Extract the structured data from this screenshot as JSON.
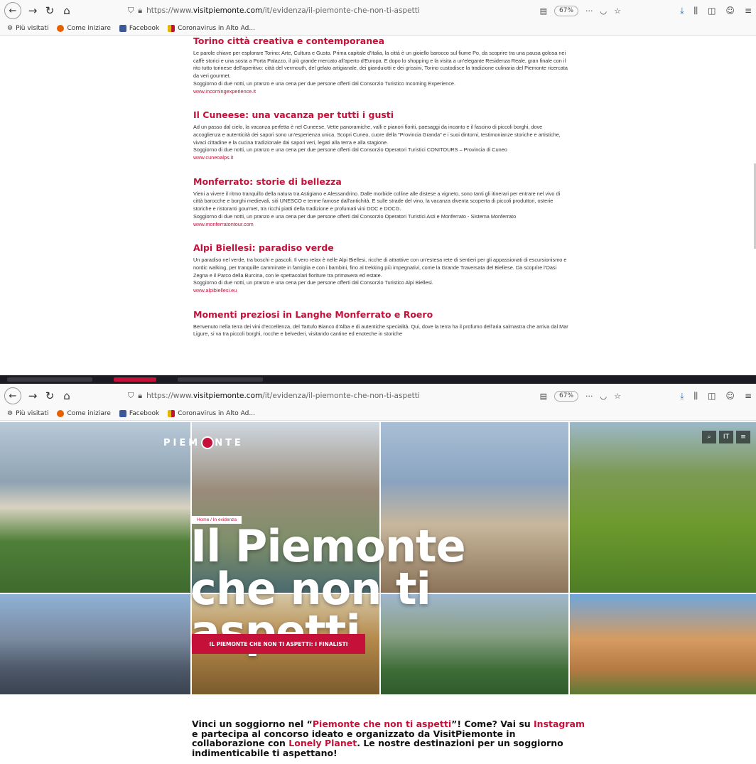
{
  "browser": {
    "url_prefix": "https://www.",
    "url_domain": "visitpiemonte.com",
    "url_path": "/it/evidenza/il-piemonte-che-non-ti-aspetti",
    "zoom": "67%",
    "more": "···",
    "bookmarks": [
      "Più visitati",
      "Come iniziare",
      "Facebook",
      "Coronavirus in Alto Ad..."
    ]
  },
  "article": {
    "sections": [
      {
        "title": "Torino città creativa e contemporanea",
        "body": "Le parole chiave per esplorare Torino: Arte, Cultura e Gusto. Prima capitale d'Italia, la città è un gioiello barocco sul fiume Po, da scoprire tra una pausa golosa nei caffè storici e una sosta a Porta Palazzo, il più grande mercato all'aperto d'Europa. E dopo lo shopping e la visita a un'elegante Residenza Reale, gran finale con il rito tutto torinese dell'aperitivo: città del vermouth, del gelato artigianale, dei gianduiotti e dei grissini, Torino custodisce la tradizione culinaria del Piemonte ricercata da veri gourmet.",
        "offer": "Soggiorno di due notti, un pranzo e una cena per due persone offerti dal Consorzio Turistico Incoming Experience.",
        "link": "www.incomingexperience.it"
      },
      {
        "title": "Il Cuneese: una vacanza per tutti i gusti",
        "body": "Ad un passo dal cielo, la vacanza perfetta è nel Cuneese. Vette panoramiche, valli e pianori fioriti, paesaggi da incanto e il fascino di piccoli borghi, dove accoglienza e autenticità dei sapori sono un'esperienza unica. Scopri Cuneo, cuore della \"Provincia Granda\" e i suoi dintorni, testimonianze storiche e artistiche, vivaci cittadine e la cucina tradizionale dai sapori veri, legati alla terra e alla stagione.",
        "offer": "Soggiorno di due notti, un pranzo e una cena per due persone offerti dal Consorzio Operatori Turistici CONITOURS – Provincia di Cuneo",
        "link": "www.cuneoalps.it"
      },
      {
        "title": "Monferrato: storie di bellezza",
        "body": "Vieni a vivere il ritmo tranquillo della natura tra Astigiano e Alessandrino. Dalle morbide colline alle distese a vigneto, sono tanti gli itinerari per entrare nel vivo di città barocche e borghi medievali, siti UNESCO e terme famose dall'antichità. E sulle strade del vino, la vacanza diventa scoperta di piccoli produttori, osterie storiche e ristoranti gourmet, tra ricchi piatti della tradizione e profumati vini DOC e DOCG.",
        "offer": "Soggiorno di due notti, un pranzo e una cena per due persone offerti dal Consorzio Operatori Turistici Asti e Monferrato - Sistema Monferrato",
        "link": "www.monferratontour.com"
      },
      {
        "title": "Alpi Biellesi: paradiso verde",
        "body": "Un paradiso nel verde, tra boschi e pascoli. Il vero relax è nelle Alpi Biellesi, ricche di attrattive con un'estesa rete di sentieri per gli appassionati di escursionismo e nordic walking, per tranquille camminate in famiglia e con i bambini, fino al trekking più impegnativi, come la Grande Traversata del Biellese. Da scoprire l'Oasi Zegna e il Parco della Burcina, con le spettacolari fioriture tra primavera ed estate.",
        "offer": "Soggiorno di due notti, un pranzo e una cena per due persone offerti dal Consorzio Turistico Alpi Biellesi.",
        "link": "www.alpibiellesi.eu"
      },
      {
        "title": "Momenti preziosi in Langhe Monferrato e Roero",
        "body": "Benvenuto nella terra dei vini d'eccellenza, del Tartufo Bianco d'Alba e di autentiche specialità. Qui, dove la terra ha il profumo dell'aria salmastra che arriva dal Mar Ligure, si va tra piccoli borghi, rocche e belvederi, visitando cantine ed enoteche in storiche",
        "offer": "",
        "link": ""
      }
    ]
  },
  "hero": {
    "logo_left": "PIEM",
    "logo_right": "NTE",
    "breadcrumb": "Home / In evidenza",
    "title": "Il Piemonte che non ti aspetti",
    "cta": "IL PIEMONTE CHE NON TI ASPETTI: I FINALISTI",
    "lang": "IT",
    "tile_colors": [
      "#3f6b2f",
      "#8b7b66",
      "#6f8aa6",
      "#7da23a",
      "#5e6d86",
      "#8a6f3e",
      "#3c6e3a",
      "#c98a4e"
    ]
  },
  "intro": {
    "p1": "Vinci un soggiorno nel “",
    "hl1": "Piemonte che non ti aspetti",
    "p2": "”! Come? Vai su ",
    "hl2": "Instagram",
    "p3": " e partecipa al concorso ideato e organizzato da VisitPiemonte  in collaborazione con ",
    "hl3": "Lonely Planet",
    "p4": ". Le nostre destinazioni per un soggiorno indimenticabile ti aspettano!"
  }
}
